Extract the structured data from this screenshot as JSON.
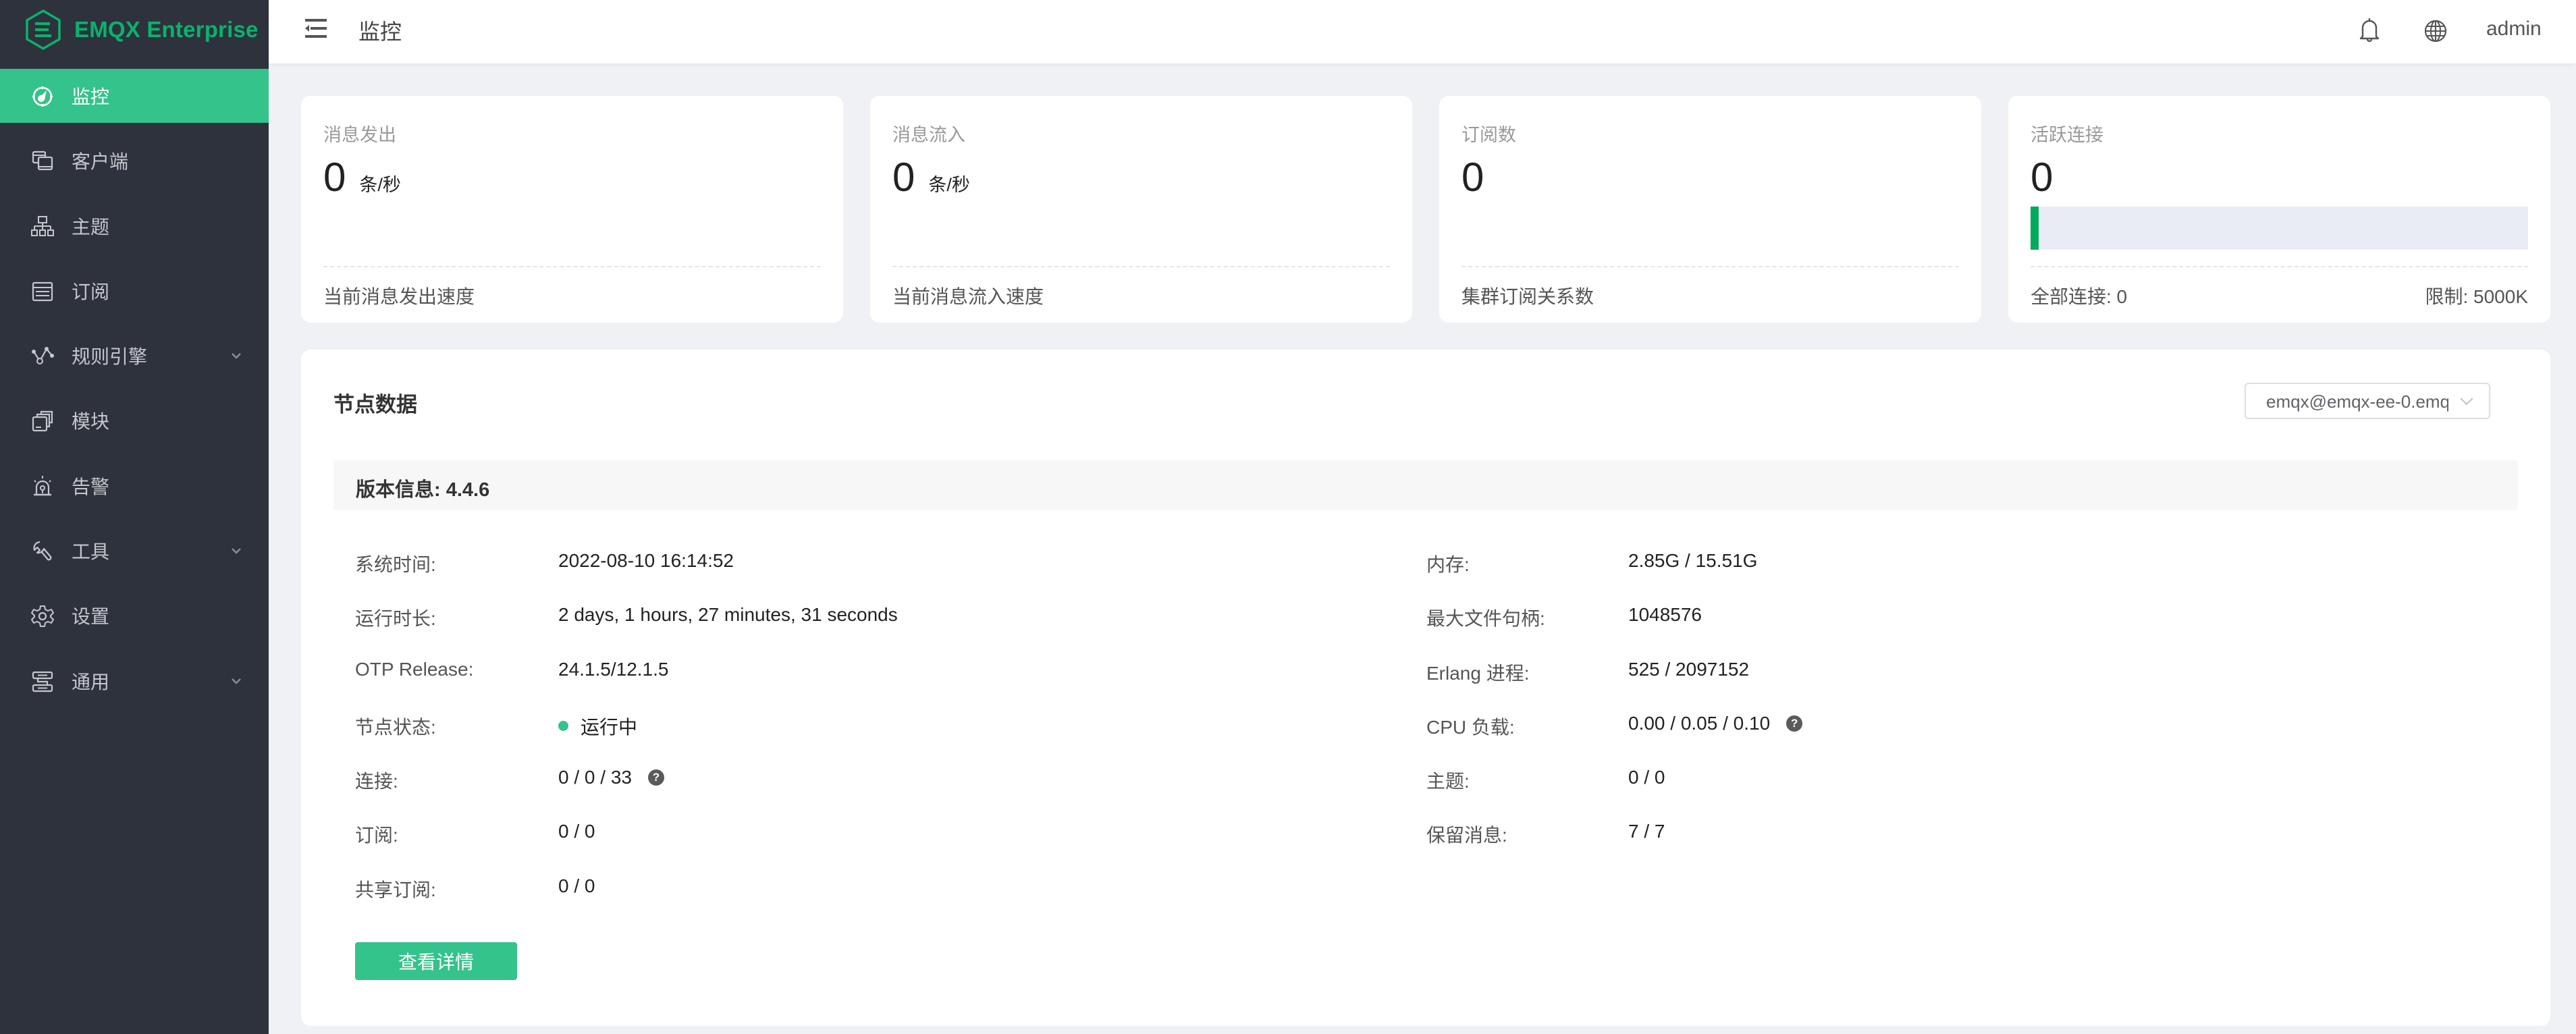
{
  "app": {
    "brand": "EMQX Enterprise",
    "brand_color": "#08b36c",
    "accent_color": "#34c38a"
  },
  "sidebar": {
    "items": [
      {
        "label": "监控",
        "icon": "dashboard-icon",
        "active": true,
        "expandable": false
      },
      {
        "label": "客户端",
        "icon": "clients-icon",
        "active": false,
        "expandable": false
      },
      {
        "label": "主题",
        "icon": "topics-icon",
        "active": false,
        "expandable": false
      },
      {
        "label": "订阅",
        "icon": "subscriptions-icon",
        "active": false,
        "expandable": false
      },
      {
        "label": "规则引擎",
        "icon": "rule-engine-icon",
        "active": false,
        "expandable": true
      },
      {
        "label": "模块",
        "icon": "modules-icon",
        "active": false,
        "expandable": false
      },
      {
        "label": "告警",
        "icon": "alarm-icon",
        "active": false,
        "expandable": false
      },
      {
        "label": "工具",
        "icon": "wrench-icon",
        "active": false,
        "expandable": true
      },
      {
        "label": "设置",
        "icon": "gear-icon",
        "active": false,
        "expandable": false
      },
      {
        "label": "通用",
        "icon": "general-icon",
        "active": false,
        "expandable": true
      }
    ]
  },
  "header": {
    "title": "监控",
    "user": "admin"
  },
  "cards": [
    {
      "title": "消息发出",
      "value": "0",
      "unit": "条/秒",
      "footer": "当前消息发出速度"
    },
    {
      "title": "消息流入",
      "value": "0",
      "unit": "条/秒",
      "footer": "当前消息流入速度"
    },
    {
      "title": "订阅数",
      "value": "0",
      "unit": "",
      "footer": "集群订阅关系数"
    },
    {
      "title": "活跃连接",
      "value": "0",
      "footer_left": "全部连接: 0",
      "footer_right": "限制: 5000K",
      "usage_fraction": 0.0
    }
  ],
  "node": {
    "title": "节点数据",
    "selected_node": "emqx@emqx-ee-0.emqx",
    "version": "版本信息: 4.4.6",
    "left": [
      {
        "label": "系统时间:",
        "value": "2022-08-10 16:14:52"
      },
      {
        "label": "运行时长:",
        "value": "2 days, 1 hours, 27 minutes, 31 seconds"
      },
      {
        "label": "OTP Release:",
        "value": "24.1.5/12.1.5"
      },
      {
        "label": "节点状态:",
        "value": "运行中",
        "status": "running"
      },
      {
        "label": "连接:",
        "value": "0 / 0 / 33",
        "help": true
      },
      {
        "label": "订阅:",
        "value": "0 / 0"
      },
      {
        "label": "共享订阅:",
        "value": "0 / 0"
      }
    ],
    "right": [
      {
        "label": "内存:",
        "value": "2.85G / 15.51G"
      },
      {
        "label": "最大文件句柄:",
        "value": "1048576"
      },
      {
        "label": "Erlang 进程:",
        "value": "525 / 2097152"
      },
      {
        "label": "CPU 负载:",
        "value": "0.00 / 0.05 / 0.10",
        "help": true
      },
      {
        "label": "主题:",
        "value": "0 / 0"
      },
      {
        "label": "保留消息:",
        "value": "7 / 7"
      }
    ],
    "help_glyph": "?",
    "detail_button": "查看详情"
  }
}
